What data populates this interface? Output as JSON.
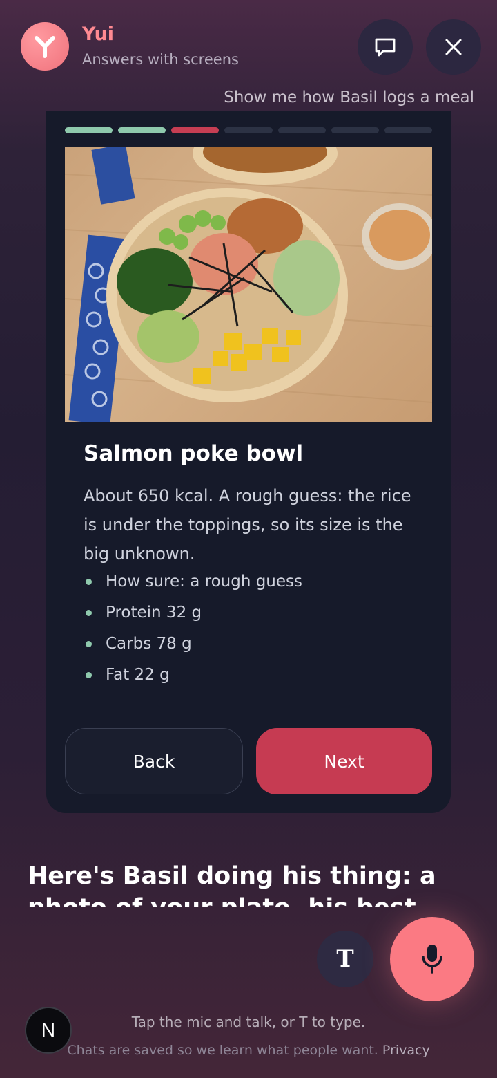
{
  "header": {
    "app_name": "Yui",
    "subtitle": "Answers with screens"
  },
  "prompt_echo": "Show me how Basil logs a meal",
  "card": {
    "progress": {
      "total_steps": 7,
      "completed_steps": 2,
      "current_step": 3
    },
    "title": "Salmon poke bowl",
    "description": "About 650 kcal. A rough guess: the rice is under the toppings, so its size is the big unknown.",
    "facts": [
      "How sure: a rough guess",
      "Protein 32 g",
      "Carbs 78 g",
      "Fat 22 g"
    ],
    "back_label": "Back",
    "next_label": "Next"
  },
  "reply_text": "Here's Basil doing his thing: a photo of your plate, his best guess",
  "composer": {
    "type_button_label": "T",
    "hint": "Tap the mic and talk, or T to type."
  },
  "footer": {
    "note": "Chats are saved so we learn what people want.",
    "privacy_label": "Privacy"
  },
  "badge_label": "N",
  "icons": {
    "logo": "yui-logo-icon",
    "chat": "chat-bubble-icon",
    "close": "close-icon",
    "mic": "microphone-icon"
  },
  "colors": {
    "accent": "#fb7a83",
    "next_button": "#c63b52",
    "progress_done": "#8fc9ad",
    "card_bg": "#161a2a"
  }
}
